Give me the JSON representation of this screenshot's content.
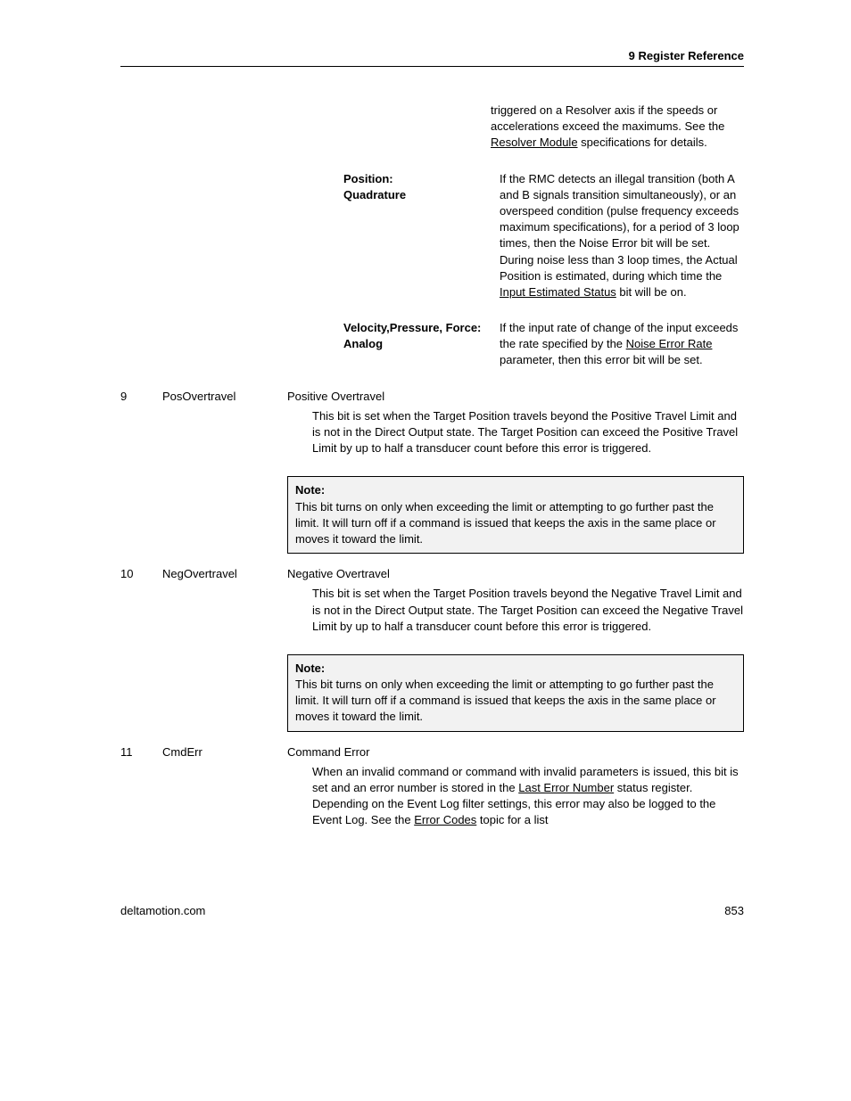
{
  "header": {
    "section": "9  Register Reference"
  },
  "continued": {
    "text_before_link": "triggered on a Resolver axis if the speeds or accelerations exceed the maximums. See the ",
    "link": "Resolver Module",
    "text_after_link": " specifications for details."
  },
  "sub_rows": [
    {
      "label_line1": "Position:",
      "label_line2": "Quadrature",
      "desc_before": "If the RMC detects an illegal transition (both A and B signals transition simultaneously), or an overspeed condition (pulse frequency exceeds maximum specifications), for a period of 3 loop times, then the Noise Error bit will be set. During noise less than 3 loop times, the Actual Position is estimated, during which time the ",
      "link": "Input Estimated Status",
      "desc_after": " bit will be on."
    },
    {
      "label_line1": "Velocity,Pressure, Force:",
      "label_line2": "Analog",
      "desc_before": "If the input rate of change of the input exceeds the rate specified by the ",
      "link": "Noise Error Rate",
      "desc_after": " parameter, then this error bit will be set."
    }
  ],
  "entries": [
    {
      "num": "9",
      "tag": "PosOvertravel",
      "title": "Positive Overtravel",
      "desc": "This bit is set when the Target Position travels beyond the Positive Travel Limit and is not in the Direct Output state. The Target Position can exceed the Positive Travel Limit by up to half a transducer count before this error is triggered.",
      "note_label": "Note:",
      "note": "This bit turns on only when exceeding the limit or attempting to go further past the limit. It will turn off if a command is issued that keeps the axis in the same place or moves it toward the limit."
    },
    {
      "num": "10",
      "tag": "NegOvertravel",
      "title": "Negative Overtravel",
      "desc": "This bit is set when the Target Position travels beyond the Negative Travel Limit and is not in the Direct Output state. The Target Position can exceed the Negative Travel Limit by up to half a transducer count before this error is triggered.",
      "note_label": "Note:",
      "note": "This bit turns on only when exceeding the limit or attempting to go further past the limit. It will turn off if a command is issued that keeps the axis in the same place or moves it toward the limit."
    },
    {
      "num": "11",
      "tag": "CmdErr",
      "title": "Command Error",
      "desc_before": "When an invalid command or command with invalid parameters is issued, this bit is set and an error number is stored in the ",
      "link1": "Last Error Number",
      "desc_mid": " status register. Depending on the Event Log filter settings, this error may also be logged to the Event Log. See the ",
      "link2": "Error Codes",
      "desc_after": " topic for a list"
    }
  ],
  "footer": {
    "site": "deltamotion.com",
    "page": "853"
  }
}
